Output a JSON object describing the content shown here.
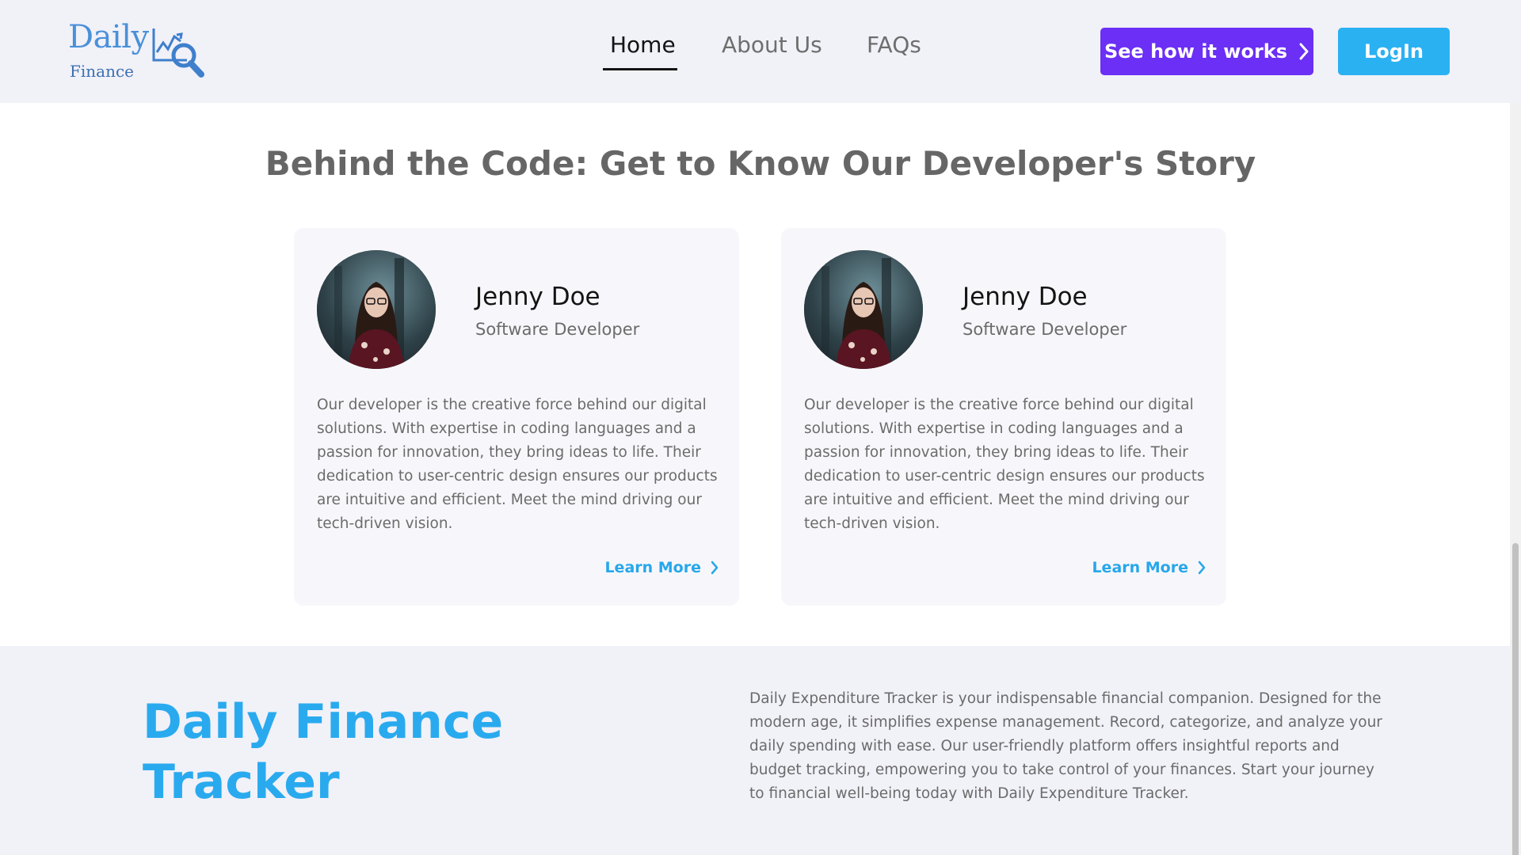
{
  "header": {
    "logo": {
      "line1": "Daily",
      "line2": "Finance"
    },
    "nav": [
      {
        "label": "Home",
        "active": true
      },
      {
        "label": "About Us",
        "active": false
      },
      {
        "label": "FAQs",
        "active": false
      }
    ],
    "cta_label": "See how it works",
    "login_label": "LogIn"
  },
  "developers": {
    "title": "Behind the Code: Get to Know Our Developer's Story",
    "cards": [
      {
        "name": "Jenny Doe",
        "role": "Software Developer",
        "bio": "Our developer is the creative force behind our digital solutions. With expertise in coding languages and a passion for innovation, they bring ideas to life. Their dedication to user-centric design ensures our products are intuitive and efficient. Meet the mind driving our tech-driven vision.",
        "link_label": "Learn More"
      },
      {
        "name": "Jenny Doe",
        "role": "Software Developer",
        "bio": "Our developer is the creative force behind our digital solutions. With expertise in coding languages and a passion for innovation, they bring ideas to life. Their dedication to user-centric design ensures our products are intuitive and efficient. Meet the mind driving our tech-driven vision.",
        "link_label": "Learn More"
      }
    ]
  },
  "footer": {
    "title": "Daily Finance Tracker",
    "description": "Daily Expenditure Tracker is your indispensable financial companion. Designed for the modern age, it simplifies expense management. Record, categorize, and analyze your daily spending with ease. Our user-friendly platform offers insightful reports and budget tracking, empowering you to take control of your finances. Start your journey to financial well-being today with Daily Expenditure Tracker."
  },
  "colors": {
    "primary_purple": "#6b2ff5",
    "accent_blue": "#2ab1f2",
    "header_bg": "#f1f1f8",
    "card_bg": "#f7f7fb"
  },
  "icons": {
    "logo": "chart-magnifier-icon",
    "cta": "chevron-right-icon",
    "learn_more": "chevron-right-icon",
    "avatar": "profile-photo"
  }
}
